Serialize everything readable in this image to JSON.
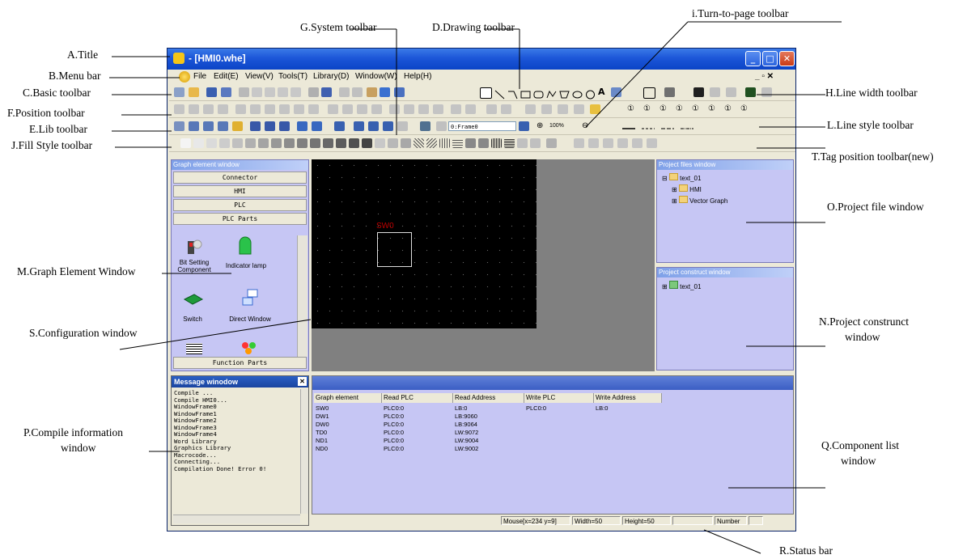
{
  "annotations": {
    "title": "A.Title",
    "menu_bar": "B.Menu bar",
    "basic_toolbar": "C.Basic toolbar",
    "drawing_toolbar": "D.Drawing toolbar",
    "lib_toolbar": "E.Lib toolbar",
    "position_toolbar": "F.Position toolbar",
    "system_toolbar": "G.System toolbar",
    "line_width_toolbar": "H.Line width  toolbar",
    "turn_to_page_toolbar": "i.Turn-to-page  toolbar",
    "fill_style_toolbar": "J.Fill Style toolbar",
    "line_style_toolbar": "L.Line style toolbar",
    "graph_element_window": "M.Graph Element Window",
    "project_construct_window_1": "N.Project construnct",
    "project_construct_window_2": "window",
    "project_file_window": "O.Project file window",
    "compile_window_1": "P.Compile information",
    "compile_window_2": "window",
    "component_list_window_1": "Q.Component list",
    "component_list_window_2": "window",
    "status_bar": "R.Status bar",
    "configuration_window": "S.Configuration window",
    "tag_position_toolbar": "T.Tag position toolbar(new)"
  },
  "window": {
    "title": " - [HMI0.whe]",
    "buttons": {
      "minimize": "_",
      "maximize": "□",
      "close": "✕"
    },
    "mdi_buttons": "_ ▫ ✕"
  },
  "menu": [
    "File",
    "Edit(E)",
    "View(V)",
    "Tools(T)",
    "Library(D)",
    "Window(W)",
    "Help(H)"
  ],
  "toolbar": {
    "frame_select": "0:Frame0",
    "zoom": "100%"
  },
  "graph_element_window": {
    "title": "Graph element window",
    "categories": [
      "Connector",
      "HMI",
      "PLC",
      "PLC Parts"
    ],
    "items": [
      {
        "label": "Bit Setting Component"
      },
      {
        "label": "Indicator lamp"
      },
      {
        "label": "Switch"
      },
      {
        "label": "Direct Window"
      }
    ],
    "bottom_category": "Function Parts"
  },
  "canvas": {
    "element_label": "SW0"
  },
  "project_files_window": {
    "title": "Project files window",
    "root": "text_01",
    "children": [
      "HMI",
      "Vector Graph"
    ]
  },
  "project_construct_window": {
    "title": "Project construct window",
    "root": "text_01"
  },
  "message_window": {
    "title": "Message winodow",
    "close": "✕",
    "lines": [
      "Compile ...",
      "Compile HMI0...",
      "WindowFrame0",
      "WindowFrame1",
      "WindowFrame2",
      "WindowFrame3",
      "WindowFrame4",
      "Word Library",
      "Graphics Library",
      "Macrocode...",
      "Connecting...",
      "Compilation Done! Error 0!"
    ]
  },
  "component_list": {
    "columns": [
      "Graph element",
      "Read PLC",
      "Read Address",
      "Write PLC",
      "Write Address"
    ],
    "rows": [
      [
        "SW0",
        "PLC0:0",
        "LB:0",
        "PLC0:0",
        "LB:0"
      ],
      [
        "DW1",
        "PLC0:0",
        "LB:9060",
        "",
        ""
      ],
      [
        "DW0",
        "PLC0:0",
        "LB:9064",
        "",
        ""
      ],
      [
        "TD0",
        "PLC0:0",
        "LW:9072",
        "",
        ""
      ],
      [
        "ND1",
        "PLC0:0",
        "LW:9004",
        "",
        ""
      ],
      [
        "ND0",
        "PLC0:0",
        "LW:9002",
        "",
        ""
      ]
    ]
  },
  "status_bar": {
    "mouse": "Mouse[x=234  y=9]",
    "width": "Width=50",
    "height": "Height=50",
    "number": "Number"
  },
  "colors": {
    "title_bar": "#1c56d8",
    "pane_bg": "#c6c6f4",
    "canvas_bg": "#000000",
    "workspace_bg": "#808080",
    "element_label": "#c00000"
  }
}
